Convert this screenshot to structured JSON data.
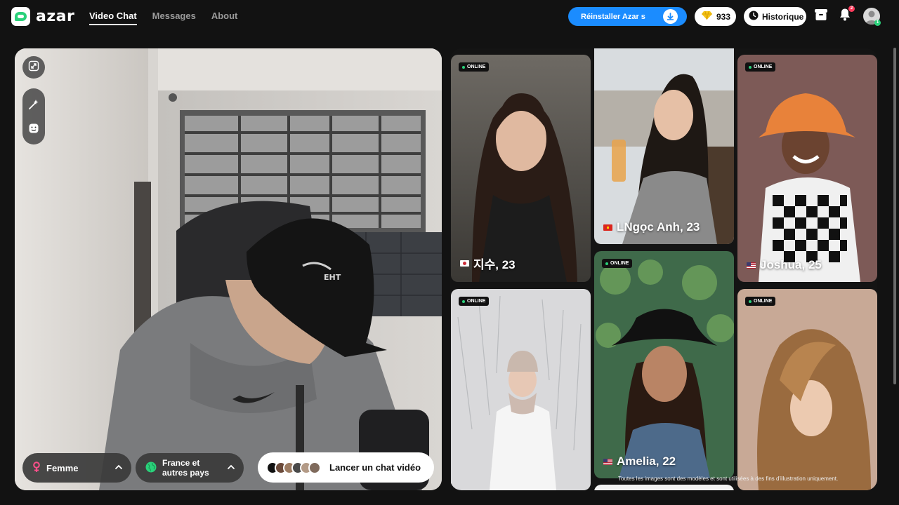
{
  "header": {
    "brand": "azar",
    "nav": [
      {
        "label": "Video Chat",
        "active": true
      },
      {
        "label": "Messages",
        "active": false
      },
      {
        "label": "About",
        "active": false
      }
    ],
    "reinstall_label": "Réinstaller Azar s",
    "gems_count": "933",
    "history_label": "Historique",
    "notification_count": "2",
    "avatar_badge_count": "1",
    "accent_color": "#1b8cff",
    "brand_color": "#2ad17a"
  },
  "video": {
    "tools": {
      "expand_icon": "expand-icon",
      "magic_icon": "magic-wand-icon",
      "face_icon": "face-filter-icon"
    },
    "gender_filter": {
      "label": "Femme",
      "icon": "female-icon"
    },
    "region_filter": {
      "label": "France et autres pays",
      "icon": "globe-icon"
    },
    "launch_label": "Lancer un chat vidéo"
  },
  "gallery": {
    "online_label": "ONLINE",
    "cards": [
      {
        "name": "지수, 23",
        "flag": "kr",
        "online": true
      },
      {
        "name": "LNgọc Anh, 23",
        "flag": "vn",
        "online": false
      },
      {
        "name": "Joshua, 25",
        "flag": "us",
        "online": true
      },
      {
        "name": "",
        "flag": "",
        "online": true
      },
      {
        "name": "Amelia, 22",
        "flag": "us",
        "online": true
      },
      {
        "name": "",
        "flag": "",
        "online": true
      }
    ],
    "disclaimer": "Toutes les images sont des modèles et sont utilisées à des fins d'illustration uniquement."
  }
}
